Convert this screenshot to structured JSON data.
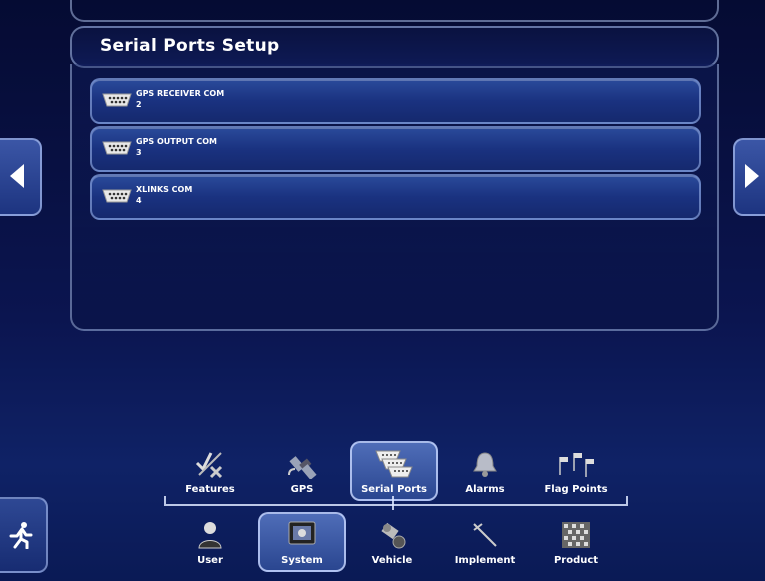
{
  "panel": {
    "title": "Serial Ports Setup"
  },
  "ports": [
    {
      "name": "GPS RECEIVER COM",
      "number": "2",
      "icon": "serial-connector-icon"
    },
    {
      "name": "GPS OUTPUT COM",
      "number": "3",
      "icon": "serial-connector-icon"
    },
    {
      "name": "XLINKS COM",
      "number": "4",
      "icon": "serial-connector-icon"
    }
  ],
  "nav_top": [
    {
      "label": "Features",
      "icon": "features-icon"
    },
    {
      "label": "GPS",
      "icon": "gps-satellite-icon"
    },
    {
      "label": "Serial Ports",
      "icon": "serial-ports-icon",
      "active": true
    },
    {
      "label": "Alarms",
      "icon": "bell-icon"
    },
    {
      "label": "Flag Points",
      "icon": "flag-points-icon"
    }
  ],
  "nav_bottom": [
    {
      "label": "User",
      "icon": "user-icon"
    },
    {
      "label": "System",
      "icon": "system-console-icon",
      "active": true
    },
    {
      "label": "Vehicle",
      "icon": "vehicle-icon"
    },
    {
      "label": "Implement",
      "icon": "implement-icon"
    },
    {
      "label": "Product",
      "icon": "product-icon"
    }
  ],
  "colors": {
    "background": "#0b1550",
    "row": "#1a3280",
    "active_tab": "#4f6db8"
  }
}
